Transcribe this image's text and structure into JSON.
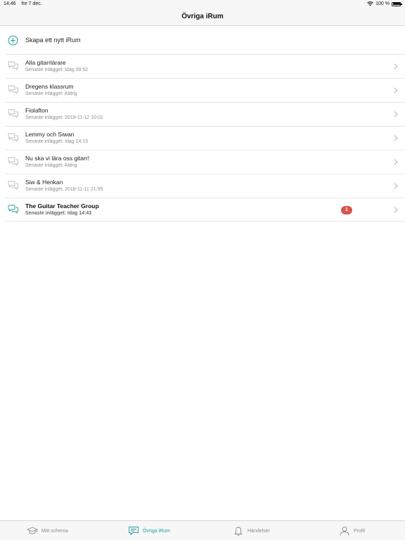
{
  "status": {
    "time": "14:46",
    "date": "fre 7 dec.",
    "battery": "100 %"
  },
  "navbar": {
    "title": "Övriga iRum"
  },
  "create": {
    "label": "Skapa ett nytt iRum",
    "icon": "plus-circle-icon"
  },
  "rooms": [
    {
      "name": "Alla gitarrlärare",
      "subtitle": "Senaste inlägget: Idag 09:52"
    },
    {
      "name": "Dregens klassrum",
      "subtitle": "Senaste inlägget: Aldrig"
    },
    {
      "name": "Fiolafton",
      "subtitle": "Senaste inlägget: 2018-11-12 10:01"
    },
    {
      "name": "Lemmy och Siwan",
      "subtitle": "Senaste inlägget: Idag 14:15"
    },
    {
      "name": "Nu ska vi lära oss gitarr!",
      "subtitle": "Senaste inlägget: Aldrig"
    },
    {
      "name": "Siw & Henkan",
      "subtitle": "Senaste inlägget: 2018-11-11 21:55"
    },
    {
      "name": "The Guitar Teacher Group",
      "subtitle": "Senaste inlägget: Idag 14:43",
      "badge": "1",
      "unread": true
    }
  ],
  "tabs": [
    {
      "label": "Mitt schema",
      "icon": "graduation-cap-icon"
    },
    {
      "label": "Övriga iRum",
      "icon": "chat-icon",
      "active": true
    },
    {
      "label": "Händelser",
      "icon": "bell-icon"
    },
    {
      "label": "Profil",
      "icon": "user-icon"
    }
  ],
  "colors": {
    "accent": "#1f9e97",
    "badge": "#d9534f",
    "muted": "#8e8e8e"
  }
}
